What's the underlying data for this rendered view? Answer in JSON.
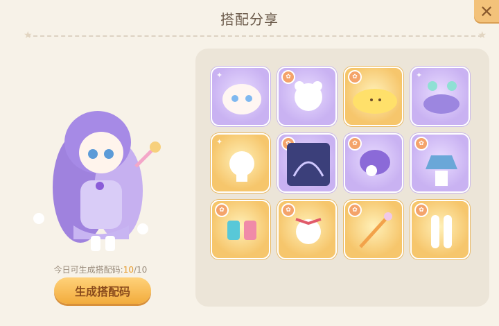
{
  "header": {
    "title": "搭配分享",
    "close_label": "✕"
  },
  "quota": {
    "label": "今日可生成搭配码:",
    "count": "10",
    "total": "/10"
  },
  "generate_button": {
    "label": "生成搭配码"
  },
  "items": [
    {
      "name": "face",
      "rarity": "purple"
    },
    {
      "name": "hair-base",
      "rarity": "purple"
    },
    {
      "name": "yellow-pet-face",
      "rarity": "gold"
    },
    {
      "name": "purple-outfit-set",
      "rarity": "purple"
    },
    {
      "name": "head-base",
      "rarity": "gold"
    },
    {
      "name": "night-garden-background",
      "rarity": "purple"
    },
    {
      "name": "purple-hair",
      "rarity": "purple"
    },
    {
      "name": "lace-skirt",
      "rarity": "purple"
    },
    {
      "name": "candy-shoes",
      "rarity": "gold"
    },
    {
      "name": "ribbon-headband",
      "rarity": "gold"
    },
    {
      "name": "magic-wand",
      "rarity": "gold"
    },
    {
      "name": "bow-stockings",
      "rarity": "gold"
    }
  ],
  "colors": {
    "purple_tile": "#c9b2f2",
    "gold_tile": "#f6c66c",
    "button": "#f2ac3c",
    "accent_count": "#e69a2a"
  }
}
